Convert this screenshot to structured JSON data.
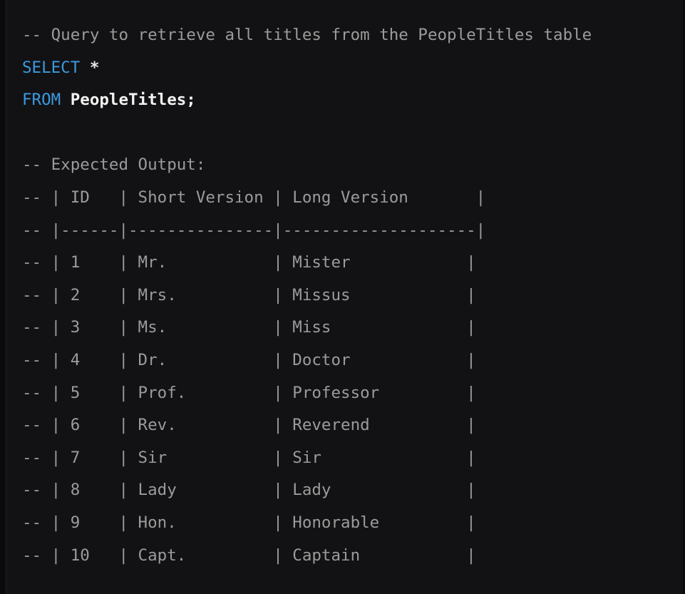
{
  "editor": {
    "background_color": "#121214",
    "comment_color": "#9b9b9b",
    "keyword_color": "#3b9ae0",
    "identifier_color": "#f2f2f2",
    "language": "sql"
  },
  "code": {
    "header_comment": "-- Query to retrieve all titles from the PeopleTitles table",
    "select_keyword": "SELECT",
    "select_star": "*",
    "from_keyword": "FROM",
    "from_table": "PeopleTitles;",
    "expected_output_comment": "-- Expected Output:",
    "comment_prefix": "-- ",
    "table_header_line": "-- | ID   | Short Version | Long Version       |",
    "table_separator_line": "-- |------|---------------|--------------------|",
    "table_rows": [
      "-- | 1    | Mr.           | Mister            |",
      "-- | 2    | Mrs.          | Missus            |",
      "-- | 3    | Ms.           | Miss              |",
      "-- | 4    | Dr.           | Doctor            |",
      "-- | 5    | Prof.         | Professor         |",
      "-- | 6    | Rev.          | Reverend          |",
      "-- | 7    | Sir           | Sir               |",
      "-- | 8    | Lady          | Lady              |",
      "-- | 9    | Hon.          | Honorable         |",
      "-- | 10   | Capt.         | Captain           |"
    ]
  },
  "table_data": {
    "type": "table",
    "columns": [
      "ID",
      "Short Version",
      "Long Version"
    ],
    "rows": [
      [
        "1",
        "Mr.",
        "Mister"
      ],
      [
        "2",
        "Mrs.",
        "Missus"
      ],
      [
        "3",
        "Ms.",
        "Miss"
      ],
      [
        "4",
        "Dr.",
        "Doctor"
      ],
      [
        "5",
        "Prof.",
        "Professor"
      ],
      [
        "6",
        "Rev.",
        "Reverend"
      ],
      [
        "7",
        "Sir",
        "Sir"
      ],
      [
        "8",
        "Lady",
        "Lady"
      ],
      [
        "9",
        "Hon.",
        "Honorable"
      ],
      [
        "10",
        "Capt.",
        "Captain"
      ]
    ]
  }
}
